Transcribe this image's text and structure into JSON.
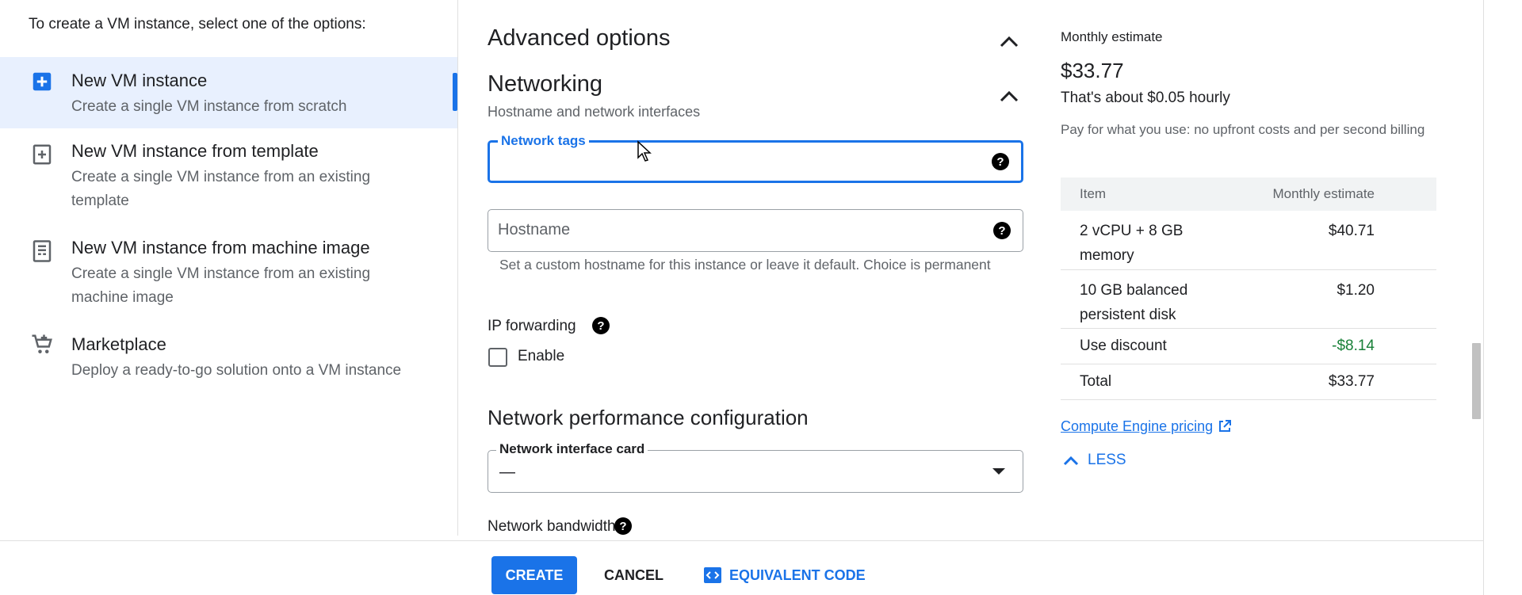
{
  "left_panel": {
    "intro": "To create a VM instance, select one of the options:",
    "options": [
      {
        "title": "New VM instance",
        "desc": "Create a single VM instance from scratch",
        "icon": "add-box-icon",
        "selected": true
      },
      {
        "title": "New VM instance from template",
        "desc": "Create a single VM instance from an existing template",
        "icon": "template-add-icon",
        "selected": false
      },
      {
        "title": "New VM instance from machine image",
        "desc": "Create a single VM instance from an existing machine image",
        "icon": "machine-image-icon",
        "selected": false
      },
      {
        "title": "Marketplace",
        "desc": "Deploy a ready-to-go solution onto a VM instance",
        "icon": "cart-icon",
        "selected": false
      }
    ]
  },
  "form": {
    "advanced_heading": "Advanced options",
    "networking_heading": "Networking",
    "networking_sub": "Hostname and network interfaces",
    "network_tags_label": "Network tags",
    "network_tags_value": "",
    "hostname_placeholder": "Hostname",
    "hostname_hint": "Set a custom hostname for this instance or leave it default. Choice is permanent",
    "ip_forwarding_label": "IP forwarding",
    "enable_label": "Enable",
    "enable_checked": false,
    "perf_heading": "Network performance configuration",
    "nic_label": "Network interface card",
    "nic_value": "—",
    "bandwidth_label": "Network bandwidth"
  },
  "summary": {
    "label": "Monthly estimate",
    "price": "$33.77",
    "hourly": "That's about $0.05 hourly",
    "note": "Pay for what you use: no upfront costs and per second billing",
    "table_headers": [
      "Item",
      "Monthly estimate"
    ],
    "rows": [
      {
        "item": "2 vCPU + 8 GB memory",
        "cost": "$40.71"
      },
      {
        "item": "10 GB balanced persistent disk",
        "cost": "$1.20"
      },
      {
        "item": "Use discount",
        "cost": "-$8.14"
      },
      {
        "item": "Total",
        "cost": "$33.77"
      }
    ],
    "pricing_link": "Compute Engine pricing",
    "less_label": "LESS"
  },
  "footer": {
    "create": "CREATE",
    "cancel": "CANCEL",
    "equivalent_code": "EQUIVALENT CODE"
  },
  "colors": {
    "accent": "#1a73e8",
    "selected_bg": "#e8f0fe",
    "discount": "#188038"
  }
}
